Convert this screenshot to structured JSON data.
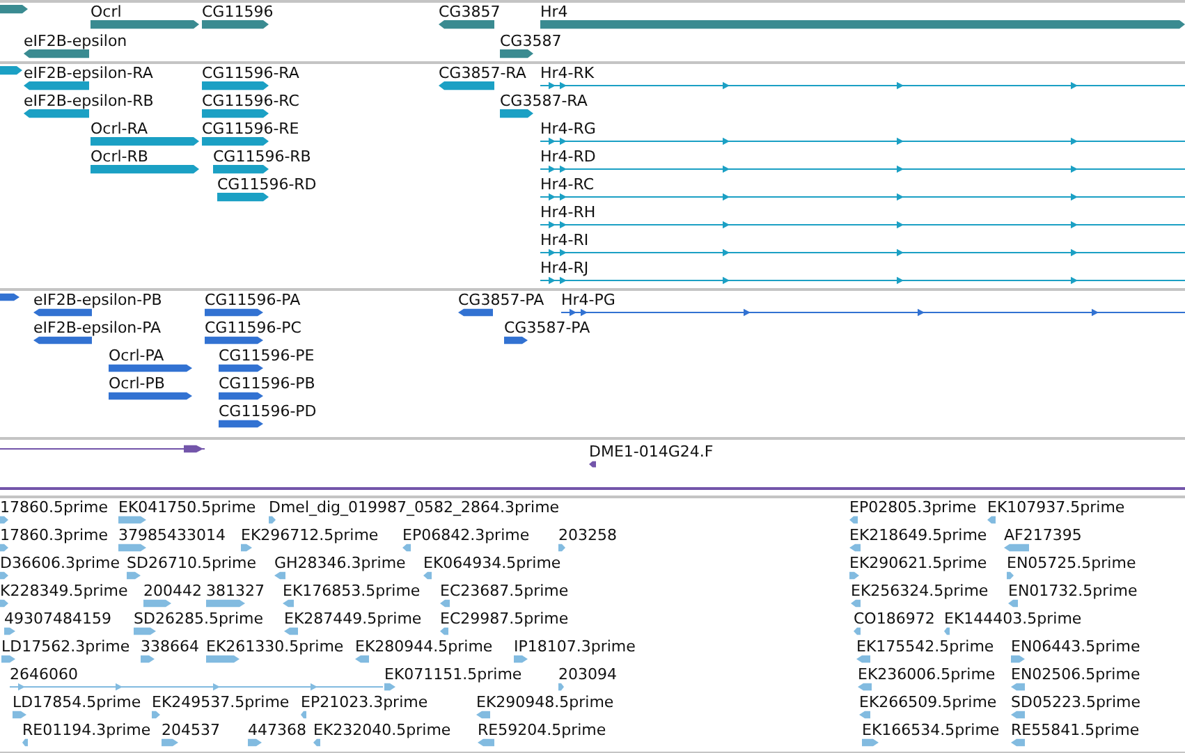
{
  "tracks": [
    {
      "kind": "gene",
      "color": "#3a8b91",
      "rows": [
        {
          "features": [
            {
              "reverse": false
            },
            {
              "label": "Ocrl",
              "reverse": false
            },
            {
              "label": "CG11596",
              "reverse": false
            },
            {
              "label": "CG3857",
              "reverse": true
            },
            {
              "label": "Hr4",
              "reverse": false
            }
          ]
        },
        {
          "features": [
            {
              "label": "eIF2B-epsilon",
              "reverse": true
            },
            {
              "label": "CG3587",
              "reverse": false
            }
          ]
        }
      ]
    },
    {
      "kind": "transcript",
      "color": "#1ba0c4",
      "rows": [
        {
          "features": [
            {
              "reverse": false
            },
            {
              "label": "eIF2B-epsilon-RA",
              "reverse": true
            },
            {
              "label": "CG11596-RA",
              "reverse": false
            },
            {
              "label": "CG3857-RA",
              "reverse": true
            },
            {
              "label": "Hr4-RK",
              "reverse": false
            }
          ]
        },
        {
          "features": [
            {
              "label": "eIF2B-epsilon-RB",
              "reverse": true
            },
            {
              "label": "CG11596-RC",
              "reverse": false
            },
            {
              "label": "CG3587-RA",
              "reverse": false
            }
          ]
        },
        {
          "features": [
            {
              "label": "Ocrl-RA",
              "reverse": false
            },
            {
              "label": "CG11596-RE",
              "reverse": false
            },
            {
              "label": "Hr4-RG",
              "reverse": false
            }
          ]
        },
        {
          "features": [
            {
              "label": "Ocrl-RB",
              "reverse": false
            },
            {
              "label": "CG11596-RB",
              "reverse": false
            },
            {
              "label": "Hr4-RD",
              "reverse": false
            }
          ]
        },
        {
          "features": [
            {
              "label": "CG11596-RD",
              "reverse": false
            },
            {
              "label": "Hr4-RC",
              "reverse": false
            }
          ]
        },
        {
          "features": [
            {
              "label": "Hr4-RH",
              "reverse": false
            }
          ]
        },
        {
          "features": [
            {
              "label": "Hr4-RI",
              "reverse": false
            }
          ]
        },
        {
          "features": [
            {
              "label": "Hr4-RJ",
              "reverse": false
            }
          ]
        }
      ]
    },
    {
      "kind": "protein",
      "color": "#3272d2",
      "rows": [
        {
          "features": [
            {
              "reverse": false
            },
            {
              "label": "eIF2B-epsilon-PB",
              "reverse": true
            },
            {
              "label": "CG11596-PA",
              "reverse": false
            },
            {
              "label": "CG3857-PA",
              "reverse": true
            },
            {
              "label": "Hr4-PG",
              "reverse": false
            }
          ]
        },
        {
          "features": [
            {
              "label": "eIF2B-epsilon-PA",
              "reverse": true
            },
            {
              "label": "CG11596-PC",
              "reverse": false
            },
            {
              "label": "CG3587-PA",
              "reverse": false
            }
          ]
        },
        {
          "features": [
            {
              "label": "Ocrl-PA",
              "reverse": false
            },
            {
              "label": "CG11596-PE",
              "reverse": false
            }
          ]
        },
        {
          "features": [
            {
              "label": "Ocrl-PB",
              "reverse": false
            },
            {
              "label": "CG11596-PB",
              "reverse": false
            }
          ]
        },
        {
          "features": [
            {
              "label": "CG11596-PD",
              "reverse": false
            }
          ]
        }
      ]
    },
    {
      "kind": "clone",
      "color": "#7355aa",
      "rows": [
        {
          "features": [
            {
              "reverse": false
            },
            {
              "label": "DME1-014G24.F",
              "reverse": true
            }
          ]
        }
      ]
    },
    {
      "kind": "est",
      "color": "#82bbe0",
      "rows": [
        {
          "features": [
            {
              "label": "17860.5prime",
              "reverse": false
            },
            {
              "label": "EK041750.5prime",
              "reverse": false
            },
            {
              "label": "Dmel_dig_019987_0582_2864.3prime",
              "reverse": false
            },
            {
              "label": "EP02805.3prime",
              "reverse": true
            },
            {
              "label": "EK107937.5prime",
              "reverse": true
            }
          ]
        },
        {
          "features": [
            {
              "label": "17860.3prime",
              "reverse": false
            },
            {
              "label": "37985433014",
              "reverse": false
            },
            {
              "label": "EK296712.5prime",
              "reverse": false
            },
            {
              "label": "EP06842.3prime",
              "reverse": true
            },
            {
              "label": "203258",
              "reverse": false
            },
            {
              "label": "EK218649.5prime",
              "reverse": true
            },
            {
              "label": "AF217395",
              "reverse": true
            }
          ]
        },
        {
          "features": [
            {
              "label": "D36606.3prime",
              "reverse": false
            },
            {
              "label": "SD26710.5prime",
              "reverse": false
            },
            {
              "label": "GH28346.3prime",
              "reverse": true
            },
            {
              "label": "EK064934.5prime",
              "reverse": true
            },
            {
              "label": "EK290621.5prime",
              "reverse": false
            },
            {
              "label": "EN05725.5prime",
              "reverse": false
            }
          ]
        },
        {
          "features": [
            {
              "label": "K228349.5prime",
              "reverse": false
            },
            {
              "label": "200442",
              "reverse": false
            },
            {
              "label": "381327",
              "reverse": false
            },
            {
              "label": "EK176853.5prime",
              "reverse": true
            },
            {
              "label": "EC23687.5prime",
              "reverse": true
            },
            {
              "label": "EK256324.5prime",
              "reverse": true
            },
            {
              "label": "EN01732.5prime",
              "reverse": true
            }
          ]
        },
        {
          "features": [
            {
              "label": "49307484159",
              "reverse": false
            },
            {
              "label": "SD26285.5prime",
              "reverse": false
            },
            {
              "label": "EK287449.5prime",
              "reverse": true
            },
            {
              "label": "EC29987.5prime",
              "reverse": true
            },
            {
              "label": "CO186972",
              "reverse": true
            },
            {
              "label": "EK144403.5prime",
              "reverse": true
            }
          ]
        },
        {
          "features": [
            {
              "label": "LD17562.3prime",
              "reverse": false
            },
            {
              "label": "338664",
              "reverse": false
            },
            {
              "label": "EK261330.5prime",
              "reverse": false
            },
            {
              "label": "EK280944.5prime",
              "reverse": true
            },
            {
              "label": "IP18107.3prime",
              "reverse": false
            },
            {
              "label": "EK175542.5prime",
              "reverse": true
            },
            {
              "label": "EN06443.5prime",
              "reverse": false
            }
          ]
        },
        {
          "features": [
            {
              "label": "2646060",
              "reverse": false
            },
            {
              "label": "EK071151.5prime",
              "reverse": false
            },
            {
              "label": "203094",
              "reverse": false
            },
            {
              "label": "EK236006.5prime",
              "reverse": true
            },
            {
              "label": "EN02506.5prime",
              "reverse": true
            }
          ]
        },
        {
          "features": [
            {
              "label": "LD17854.5prime",
              "reverse": false
            },
            {
              "label": "EK249537.5prime",
              "reverse": false
            },
            {
              "label": "EP21023.3prime",
              "reverse": true
            },
            {
              "label": "EK290948.5prime",
              "reverse": true
            },
            {
              "label": "EK266509.5prime",
              "reverse": true
            },
            {
              "label": "SD05223.5prime",
              "reverse": true
            }
          ]
        },
        {
          "features": [
            {
              "label": "RE01194.3prime",
              "reverse": true
            },
            {
              "label": "204537",
              "reverse": false
            },
            {
              "label": "447368",
              "reverse": false
            },
            {
              "label": "EK232040.5prime",
              "reverse": true
            },
            {
              "label": "RE59204.5prime",
              "reverse": true
            },
            {
              "label": "EK166534.5prime",
              "reverse": false
            },
            {
              "label": "RE55841.5prime",
              "reverse": true
            }
          ]
        }
      ]
    }
  ]
}
